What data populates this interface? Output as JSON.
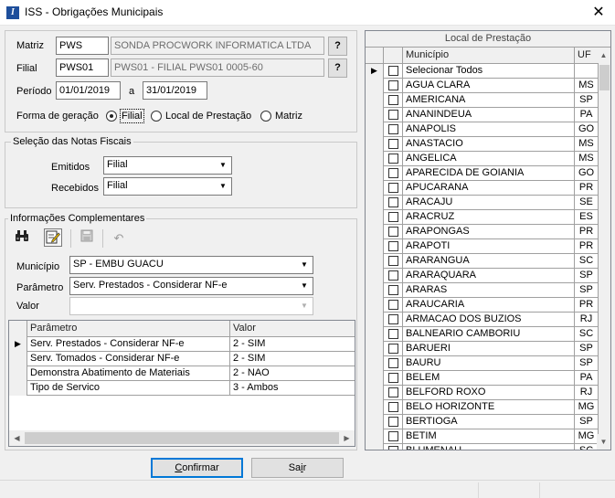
{
  "window": {
    "title": "ISS - Obrigações Municipais",
    "close_label": "✕",
    "app_icon_letter": "I"
  },
  "header": {
    "matriz": {
      "label": "Matriz",
      "code": "PWS",
      "name": "SONDA PROCWORK INFORMATICA LTDA",
      "lookup_label": "?"
    },
    "filial": {
      "label": "Filial",
      "code": "PWS01",
      "name": "PWS01 - FILIAL PWS01 0005-60",
      "lookup_label": "?"
    },
    "periodo": {
      "label": "Período",
      "start": "01/01/2019",
      "sep": "a",
      "end": "31/01/2019"
    },
    "forma_geracao": {
      "label": "Forma de geração",
      "options": [
        "Filial",
        "Local de Prestação",
        "Matriz"
      ],
      "selected": "Filial"
    }
  },
  "selecao": {
    "title": "Seleção das Notas Fiscais",
    "emitidos": {
      "label": "Emitidos",
      "value": "Filial"
    },
    "recebidos": {
      "label": "Recebidos",
      "value": "Filial"
    }
  },
  "complementares": {
    "title": "Informações Complementares",
    "toolbar": [
      "binoculars-icon",
      "edit-icon",
      "save-icon",
      "undo-icon"
    ],
    "municipio": {
      "label": "Município",
      "value": "SP - EMBU GUACU"
    },
    "parametro": {
      "label": "Parâmetro",
      "value": "Serv. Prestados - Considerar NF-e"
    },
    "valor": {
      "label": "Valor",
      "value": ""
    },
    "grid": {
      "columns": [
        "Parâmetro",
        "Valor"
      ],
      "rows": [
        {
          "parametro": "Serv. Prestados - Considerar NF-e",
          "valor": "2 - SIM",
          "current": true
        },
        {
          "parametro": "Serv. Tomados - Considerar NF-e",
          "valor": "2 - SIM"
        },
        {
          "parametro": "Demonstra Abatimento de Materiais",
          "valor": "2 - NAO"
        },
        {
          "parametro": "Tipo de Servico",
          "valor": "3 - Ambos"
        }
      ]
    }
  },
  "local_prestacao": {
    "title": "Local de Prestação",
    "columns": [
      "Município",
      "UF"
    ],
    "rows": [
      {
        "municipio": "Selecionar Todos",
        "uf": "",
        "current": true
      },
      {
        "municipio": "AGUA CLARA",
        "uf": "MS"
      },
      {
        "municipio": "AMERICANA",
        "uf": "SP"
      },
      {
        "municipio": "ANANINDEUA",
        "uf": "PA"
      },
      {
        "municipio": "ANAPOLIS",
        "uf": "GO"
      },
      {
        "municipio": "ANASTACIO",
        "uf": "MS"
      },
      {
        "municipio": "ANGELICA",
        "uf": "MS"
      },
      {
        "municipio": "APARECIDA DE GOIANIA",
        "uf": "GO"
      },
      {
        "municipio": "APUCARANA",
        "uf": "PR"
      },
      {
        "municipio": "ARACAJU",
        "uf": "SE"
      },
      {
        "municipio": "ARACRUZ",
        "uf": "ES"
      },
      {
        "municipio": "ARAPONGAS",
        "uf": "PR"
      },
      {
        "municipio": "ARAPOTI",
        "uf": "PR"
      },
      {
        "municipio": "ARARANGUA",
        "uf": "SC"
      },
      {
        "municipio": "ARARAQUARA",
        "uf": "SP"
      },
      {
        "municipio": "ARARAS",
        "uf": "SP"
      },
      {
        "municipio": "ARAUCARIA",
        "uf": "PR"
      },
      {
        "municipio": "ARMACAO DOS BUZIOS",
        "uf": "RJ"
      },
      {
        "municipio": "BALNEARIO CAMBORIU",
        "uf": "SC"
      },
      {
        "municipio": "BARUERI",
        "uf": "SP"
      },
      {
        "municipio": "BAURU",
        "uf": "SP"
      },
      {
        "municipio": "BELEM",
        "uf": "PA"
      },
      {
        "municipio": "BELFORD ROXO",
        "uf": "RJ"
      },
      {
        "municipio": "BELO HORIZONTE",
        "uf": "MG"
      },
      {
        "municipio": "BERTIOGA",
        "uf": "SP"
      },
      {
        "municipio": "BETIM",
        "uf": "MG"
      },
      {
        "municipio": "BLUMENAU",
        "uf": "SC"
      }
    ]
  },
  "actions": {
    "confirmar": "Confirmar",
    "sair": "Sair"
  }
}
